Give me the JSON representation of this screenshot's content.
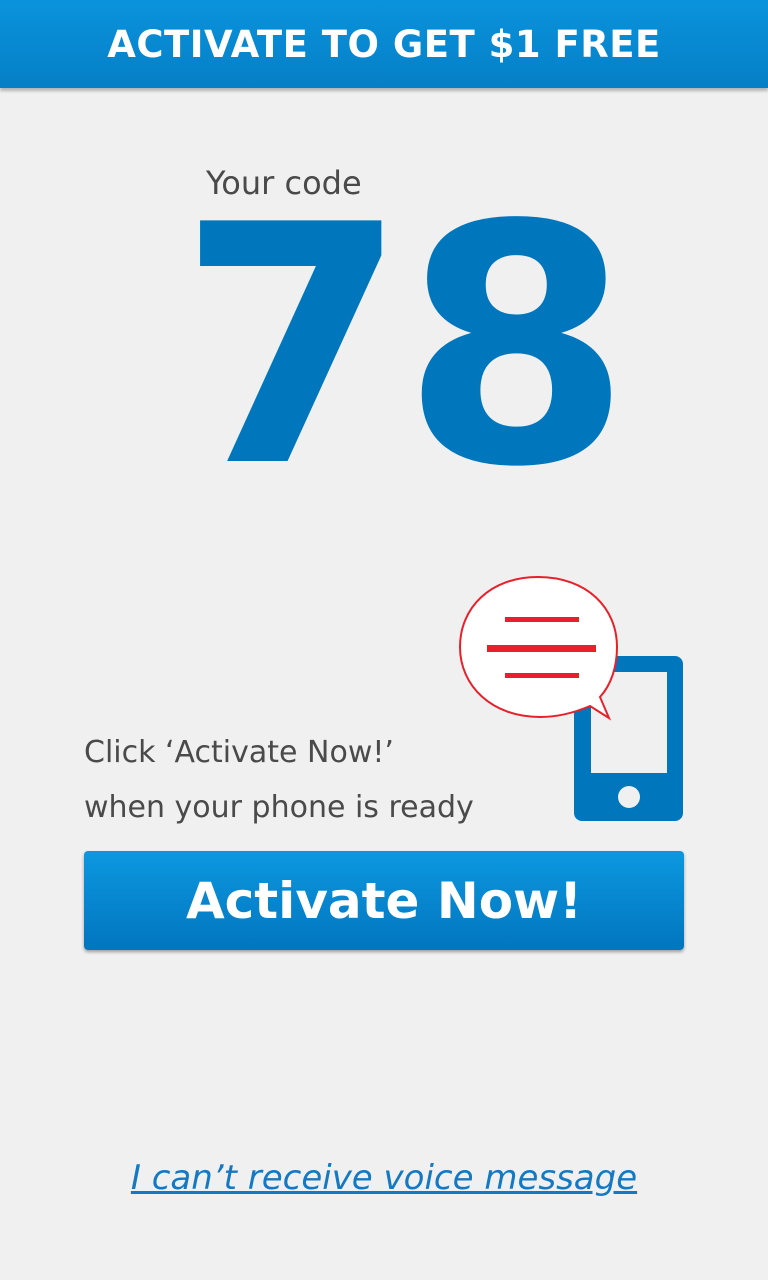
{
  "header": {
    "title": "ACTIVATE TO GET $1 FREE"
  },
  "code": {
    "label": "Your code",
    "value": "78"
  },
  "instruction": {
    "line1": "Click ‘Activate Now!’",
    "line2": "when your phone is ready"
  },
  "activate_button": {
    "label": "Activate Now!"
  },
  "voice_link": {
    "label": "I can’t receive voice message"
  },
  "colors": {
    "accent": "#0077bd",
    "header_bg": "#0a8ad4",
    "speech_bubble": "#e8202a",
    "background": "#f0f0f0"
  },
  "icons": {
    "illustration": "phone-with-message-bubble-icon"
  }
}
